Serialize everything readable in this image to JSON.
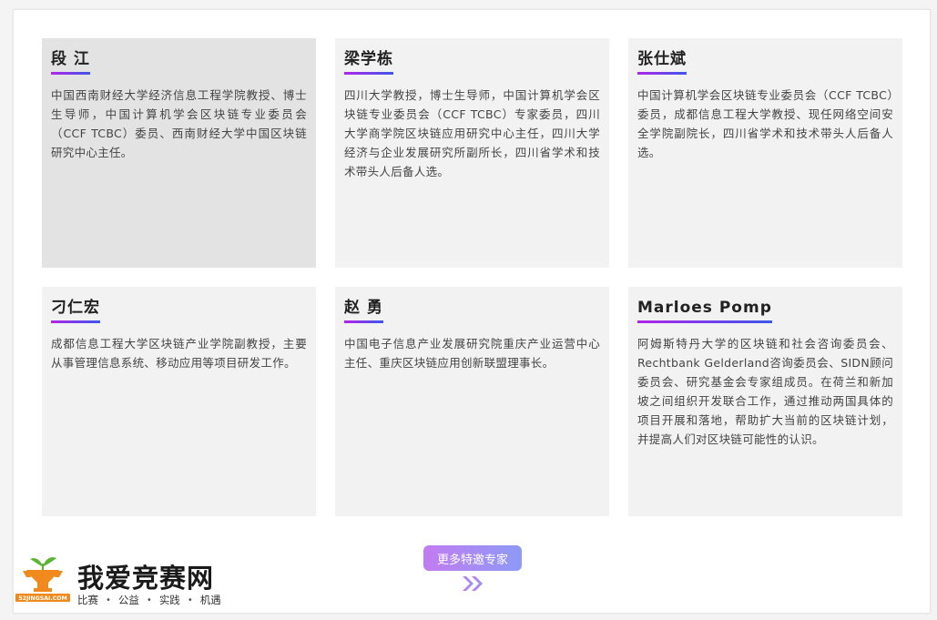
{
  "experts": [
    {
      "name": "段 江",
      "bio": "中国西南财经大学经济信息工程学院教授、博士生导师，中国计算机学会区块链专业委员会（CCF TCBC）委员、西南财经大学中国区块链研究中心主任。"
    },
    {
      "name": "梁学栋",
      "bio": "四川大学教授，博士生导师，中国计算机学会区块链专业委员会（CCF TCBC）专家委员，四川大学商学院区块链应用研究中心主任，四川大学经济与企业发展研究所副所长，四川省学术和技术带头人后备人选。"
    },
    {
      "name": "张仕斌",
      "bio": "中国计算机学会区块链专业委员会（CCF TCBC）委员，成都信息工程大学教授、现任网络空间安全学院副院长，四川省学术和技术带头人后备人选。"
    },
    {
      "name": "刁仁宏",
      "bio": "成都信息工程大学区块链产业学院副教授，主要从事管理信息系统、移动应用等项目研发工作。"
    },
    {
      "name": "赵 勇",
      "bio": "中国电子信息产业发展研究院重庆产业运营中心主任、重庆区块链应用创新联盟理事长。"
    },
    {
      "name": "Marloes Pomp",
      "bio": "阿姆斯特丹大学的区块链和社会咨询委员会、Rechtbank Gelderland咨询委员会、SIDN顾问委员会、研究基金会专家组成员。在荷兰和新加坡之间组织开发联合工作，通过推动两国具体的项目开展和落地，帮助扩大当前的区块链计划，并提高人们对区块链可能性的认识。"
    }
  ],
  "more_button": {
    "label": "更多特邀专家"
  },
  "logo": {
    "title": "我爱竞赛网",
    "small_text": "52JINGSAI.COM",
    "tags": [
      "比赛",
      "公益",
      "实践",
      "机遇"
    ],
    "tag_separator": "•"
  },
  "colors": {
    "underline_start": "#b026e8",
    "underline_end": "#3d56ea",
    "card_bg": "#f2f2f2",
    "card_active_bg": "#e3e3e3",
    "button_start": "#c27cf2",
    "button_end": "#8d9af5",
    "logo_orange": "#f08a1c",
    "logo_green": "#5bb532"
  },
  "icons": {
    "chevrons": "double-chevron-right-icon",
    "logo_mark": "trophy-sprout-logo-icon"
  }
}
